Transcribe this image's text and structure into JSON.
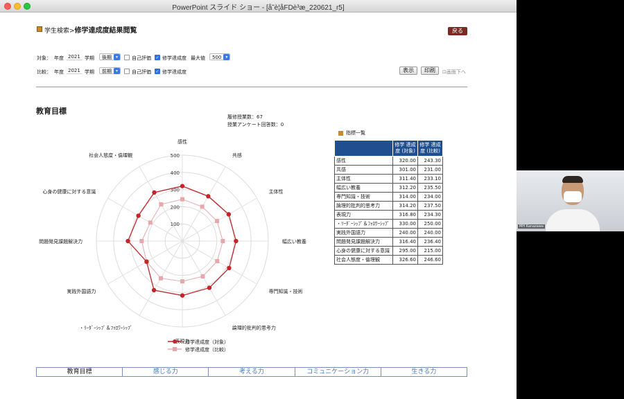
{
  "window": {
    "title": "PowerPoint スライド ショー - [å˜è¦åFDè³æ_220621_r5]"
  },
  "header": {
    "breadcrumb_link": "学生検索>",
    "breadcrumb_title": "修学達成度結果閲覧",
    "back_label": "戻る"
  },
  "filters": {
    "target": {
      "label": "対象：",
      "year_label": "年度",
      "year_value": "2021",
      "term_label": "学期",
      "term_value": "後期",
      "self_eval_label": "自己評価",
      "self_eval_checked": false,
      "achieve_label": "修学達成度",
      "max_label": "最大値",
      "max_value": "500"
    },
    "compare": {
      "label": "比較：",
      "year_label": "年度",
      "year_value": "2021",
      "term_label": "学期",
      "term_value": "前期",
      "self_eval_label": "自己評価",
      "self_eval_checked": false,
      "achieve_label": "修学達成度"
    },
    "display_label": "表示",
    "print_label": "印刷",
    "page_top_label": "画面下へ"
  },
  "section": {
    "title": "教育目標",
    "course_count_label": "履修授業数：",
    "course_count": "67",
    "survey_count_label": "授業アンケート回答数：",
    "survey_count": "0"
  },
  "chart_data": {
    "type": "radar",
    "categories": [
      "感性",
      "共感",
      "主体性",
      "幅広い教養",
      "専門知識・技術",
      "論理的批判的思考力",
      "表現力",
      "・ﾘｰﾀﾞｰｼｯﾌﾟ＆ﾌｫﾛﾜｰｼｯﾌﾟ",
      "実践外国語力",
      "問題発見課題解決力",
      "心身の健康に対する意識",
      "社会人態度・倫理観"
    ],
    "rmax": 500,
    "ticks": [
      "100",
      "200",
      "300",
      "400",
      "500"
    ],
    "series": [
      {
        "name": "修学達成度（対象）",
        "color": "#c0272d",
        "values": [
          320.0,
          301.0,
          311.4,
          312.2,
          314.0,
          314.2,
          316.8,
          330.0,
          240.0,
          316.4,
          295.0,
          326.6
        ]
      },
      {
        "name": "修学達成度（比較）",
        "color": "#e8a8ab",
        "values": [
          243.3,
          231.0,
          233.1,
          235.5,
          234.0,
          237.5,
          234.3,
          250.0,
          240.0,
          236.4,
          215.0,
          246.6
        ]
      }
    ],
    "legend": "bottom"
  },
  "table": {
    "title": "指標一覧",
    "header_target": "修学 達成度 (対象)",
    "header_compare": "修学 達成度 (比較)",
    "rows": [
      {
        "name": "感性",
        "target": "320.00",
        "compare": "243.30"
      },
      {
        "name": "共感",
        "target": "301.00",
        "compare": "231.00"
      },
      {
        "name": "主体性",
        "target": "311.40",
        "compare": "233.10"
      },
      {
        "name": "幅広い教養",
        "target": "312.20",
        "compare": "235.50"
      },
      {
        "name": "専門知識・技術",
        "target": "314.00",
        "compare": "234.00"
      },
      {
        "name": "論理的批判的思考力",
        "target": "314.20",
        "compare": "237.50"
      },
      {
        "name": "表現力",
        "target": "316.80",
        "compare": "234.30"
      },
      {
        "name": "・ﾘｰﾀﾞｰｼｯﾌﾟ＆ﾌｫﾛﾜｰｼｯﾌﾟ",
        "target": "330.00",
        "compare": "250.00"
      },
      {
        "name": "実践外国語力",
        "target": "240.00",
        "compare": "240.00"
      },
      {
        "name": "問題発見課題解決力",
        "target": "316.40",
        "compare": "236.40"
      },
      {
        "name": "心身の健康に対する意識",
        "target": "295.00",
        "compare": "215.00"
      },
      {
        "name": "社会人態度・倫理観",
        "target": "326.60",
        "compare": "246.60"
      }
    ]
  },
  "tabs": [
    "教育目標",
    "感じる力",
    "考える力",
    "コミュニケーション力",
    "生きる力"
  ],
  "video": {
    "name": "MH Kanazawa"
  }
}
